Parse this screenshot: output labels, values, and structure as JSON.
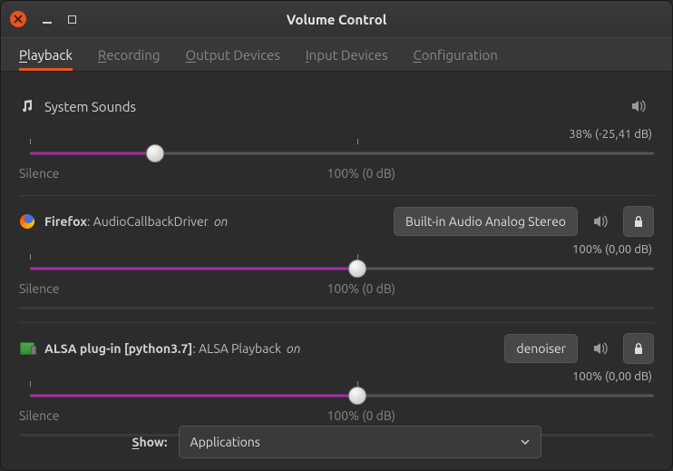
{
  "window": {
    "title": "Volume Control"
  },
  "tabs": [
    {
      "pre": "P",
      "rest": "layback",
      "active": true
    },
    {
      "pre": "R",
      "rest": "ecording",
      "active": false
    },
    {
      "pre": "O",
      "rest": "utput Devices",
      "active": false
    },
    {
      "pre": "I",
      "rest": "nput Devices",
      "active": false
    },
    {
      "pre": "C",
      "rest": "onfiguration",
      "active": false
    }
  ],
  "streams": {
    "system": {
      "label": "System Sounds",
      "db": "38% (-25,41 dB)",
      "silence": "Silence",
      "hundred": "100% (0 dB)",
      "fill_pct": 20,
      "thumb_pct": 20,
      "hundred_pos_pct": 52.5
    },
    "firefox": {
      "app": "Firefox",
      "sep": ": ",
      "sub": "AudioCallbackDriver",
      "on": "on",
      "sink": "Built-in Audio Analog Stereo",
      "db": "100% (0,00 dB)",
      "silence": "Silence",
      "hundred": "100% (0 dB)",
      "fill_pct": 52.5,
      "thumb_pct": 52.5,
      "hundred_pos_pct": 52.5
    },
    "alsa": {
      "app": "ALSA plug-in [python3.7]",
      "sep": ": ",
      "sub": "ALSA Playback",
      "on": "on",
      "sink": "denoiser",
      "db": "100% (0,00 dB)",
      "silence": "Silence",
      "hundred": "100% (0 dB)",
      "fill_pct": 52.5,
      "thumb_pct": 52.5,
      "hundred_pos_pct": 52.5
    }
  },
  "footer": {
    "show_pre": "S",
    "show_rest": "how:",
    "value": "Applications"
  }
}
